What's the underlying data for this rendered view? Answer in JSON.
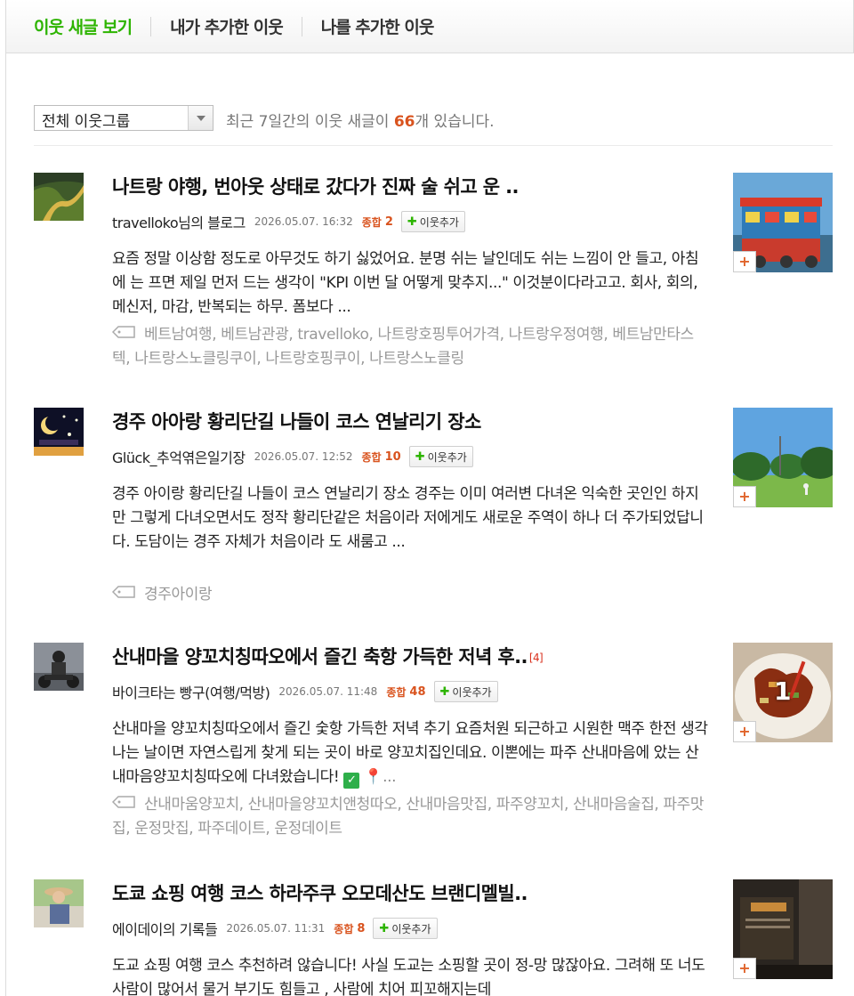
{
  "tabs": [
    {
      "label": "이웃 새글 보기"
    },
    {
      "label": "내가 추가한 이웃"
    },
    {
      "label": "나를 추가한 이웃"
    }
  ],
  "filter": {
    "group_select": "전체 이웃그룹",
    "summary_prefix": "최근 7일간의 이웃 새글이 ",
    "summary_count": "66",
    "summary_suffix": "개 있습니다."
  },
  "add_label": "이웃추가",
  "score_label": "종합",
  "posts": [
    {
      "title": "나트랑 야행, 번아웃 상태로 갔다가 진짜 술 쉬고 운 ..",
      "comment_count": "",
      "author": "travelloko님의 블로그",
      "date": "2026.05.07. 16:32",
      "score": "2",
      "body": "요즘 정말 이상함 정도로 아무것도 하기 싫었어요. 분명 쉬는 날인데도 쉬는 느낌이 안 들고, 아침에 는 프면 제일 먼저 드는 생각이 \"KPI 이번 달 어떻게 맞추지...\" 이것분이다라고고. 회사, 회의, 메신저, 마감, 반복되는 하무. 폼보다 ...",
      "tags": "베트남여행, 베트남관광, travelloko, 나트랑호핑투어가격, 나트랑우정여행, 베트남만타스텍, 나트랑스노클링쿠이, 나트랑호핑쿠이, 나트랑스노클링",
      "thumb_count": ""
    },
    {
      "title": "경주 아아랑 황리단길 나들이 코스 연날리기 장소",
      "comment_count": "",
      "author": "Glück_추억엮은일기장",
      "date": "2026.05.07. 12:52",
      "score": "10",
      "body": "경주 아이랑 황리단길 나들이 코스 연날리기 장소 경주는 이미 여러변 다녀온 익숙한 곳인인 하지만 그렇게 다녀오면서도 정작 황리단같은 처음이라 저에게도 새로운 주역이 하나 더 주가되었답니다. 도담이는 경주 자체가 처음이라 도 새룸고 ...",
      "tags": "경주아이랑",
      "thumb_count": ""
    },
    {
      "title": "산내마을 양꼬치칭따오에서 즐긴 축항 가득한 저녁 후..",
      "comment_count": "[4]",
      "author": "바이크타는 빵구(여행/먹방)",
      "date": "2026.05.07. 11:48",
      "score": "48",
      "body": "산내마을 양꼬치칭따오에서 즐긴 숯항 가득한 저녁 추기 요즘처원 되근하고 시원한 맥주 한전 생각나는 날이면 자연스립게 찾게 되는 곳이 바로 양꼬치집인데요. 이뽄에는 파주 산내마음에 았는 산내마음양꼬치칭따오에 다녀왔습니다!",
      "tags": "산내마움양꼬치, 산내마을양꼬치앤청따오, 산내마음맛집, 파주양꼬치, 산내마음술집, 파주맛집, 운정맛집, 파주데이트, 운정데이트",
      "thumb_count": "1"
    },
    {
      "title": "도쿄 쇼핑 여행 코스 하라주쿠 오모데산도 브랜디멜빌..",
      "comment_count": "",
      "author": "에이데이의 기록들",
      "date": "2026.05.07. 11:31",
      "score": "8",
      "body": "도교 쇼핑 여행 코스 추천하려 않습니다! 사실 도교는 소핑할 곳이 정-망 많잖아요. 그려해 또 너도 사람이 많어서 물거 부기도 힘들고 , 사람에 치어 피꼬해지는데",
      "tags": "",
      "thumb_count": ""
    }
  ]
}
